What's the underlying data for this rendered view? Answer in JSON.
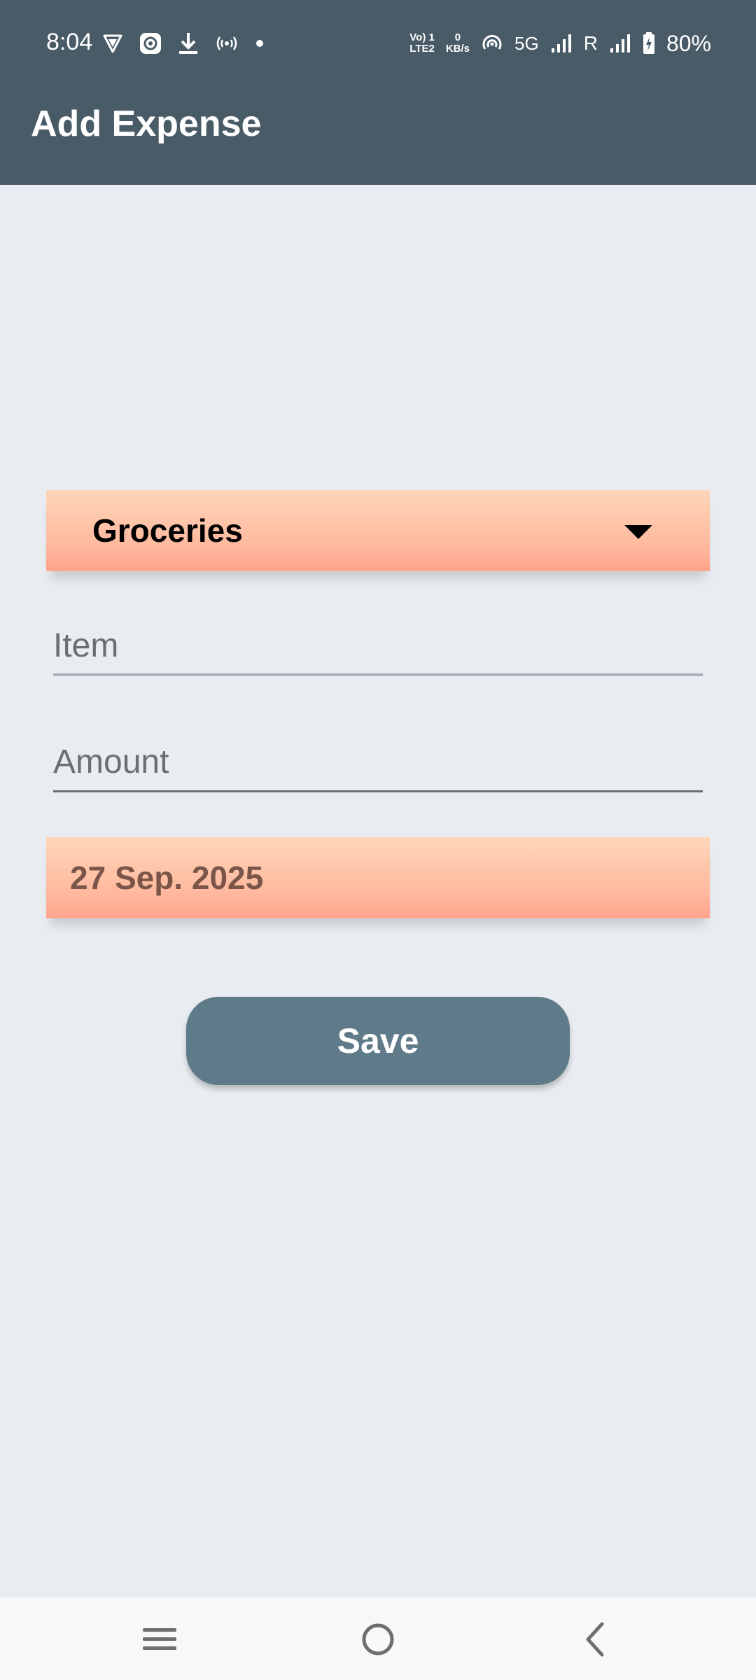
{
  "status_bar": {
    "time": "8:04",
    "volte_top": "Vo) 1",
    "volte_bottom": "LTE2",
    "speed_value": "0",
    "speed_unit": "KB/s",
    "network": "5G",
    "roaming": "R",
    "battery": "80%"
  },
  "app_bar": {
    "title": "Add Expense"
  },
  "form": {
    "category_selected": "Groceries",
    "item_placeholder": "Item",
    "item_value": "",
    "amount_placeholder": "Amount",
    "amount_value": "",
    "date": "27 Sep. 2025",
    "save_label": "Save"
  },
  "colors": {
    "app_bar": "#485B67",
    "background": "#E9EDF1",
    "dropdown_gradient_top": "#FFD6B8",
    "dropdown_gradient_bottom": "#FFA48C",
    "save_button": "#5F7A88",
    "date_text": "#7A5548"
  },
  "nav_bar": {
    "icons": [
      "recents-icon",
      "home-icon",
      "back-icon"
    ]
  }
}
